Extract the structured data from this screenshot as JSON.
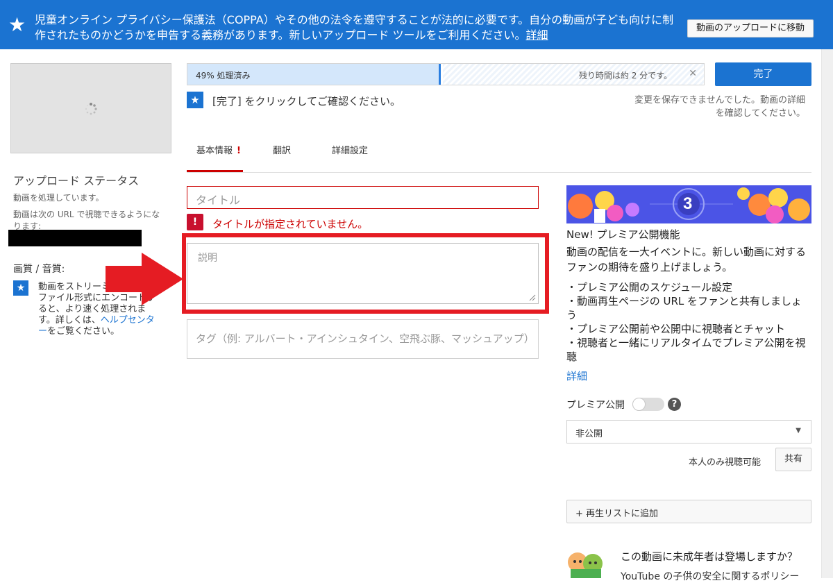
{
  "banner": {
    "text": "児童オンライン プライバシー保護法（COPPA）やその他の法令を遵守することが法的に必要です。自分の動画が子ども向けに制作されたものかどうかを申告する義務があります。新しいアップロード ツールをご利用ください。",
    "link": "詳細",
    "move_button": "動画のアップロードに移動"
  },
  "upload_status": {
    "title": "アップロード ステータス",
    "processing": "動画を処理しています。",
    "url_text": "動画は次の URL で視聴できるようになります:"
  },
  "quality": {
    "title": "画質 / 音質:",
    "text_before": "動画をストリーミング可能なファイル形式にエンコードすると、より速く処理されます。詳しくは、",
    "link": "ヘルプセンター",
    "text_after": "をご覧ください。"
  },
  "progress": {
    "label": "49% 処理済み",
    "percent": 49,
    "remaining": "残り時間は約 2 分です。"
  },
  "done_button": "完了",
  "confirm_text": "[完了] をクリックしてご確認ください。",
  "save_error": "変更を保存できませんでした。動画の詳細を確認してください。",
  "tabs": {
    "basic": "基本情報",
    "basic_alert": "!",
    "translate": "翻訳",
    "advanced": "詳細設定"
  },
  "form": {
    "title_placeholder": "タイトル",
    "title_error": "タイトルが指定されていません。",
    "description_placeholder": "説明",
    "tags_placeholder": "タグ（例: アルバート・アインシュタイン、空飛ぶ豚、マッシュアップ）"
  },
  "premiere": {
    "title": "New! プレミア公開機能",
    "description": "動画の配信を一大イベントに。新しい動画に対するファンの期待を盛り上げましょう。",
    "bullets": [
      "・プレミア公開のスケジュール設定",
      "・動画再生ページの URL をファンと共有しましょう",
      "・プレミア公開前や公開中に視聴者とチャット",
      "・視聴者と一緒にリアルタイムでプレミア公開を視聴"
    ],
    "more": "詳細",
    "countdown": "3",
    "toggle_label": "プレミア公開",
    "help": "?"
  },
  "privacy": {
    "selected": "非公開",
    "note": "本人のみ視聴可能",
    "share_button": "共有"
  },
  "playlist_button": "+ 再生リストに追加",
  "kids": {
    "title": "この動画に未成年者は登場しますか？",
    "subtitle": "YouTube の子供の安全に関するポリシー"
  },
  "colors": {
    "brand_blue": "#1b73d1",
    "error_red": "#cc0000",
    "highlight_red": "#e51c23"
  }
}
